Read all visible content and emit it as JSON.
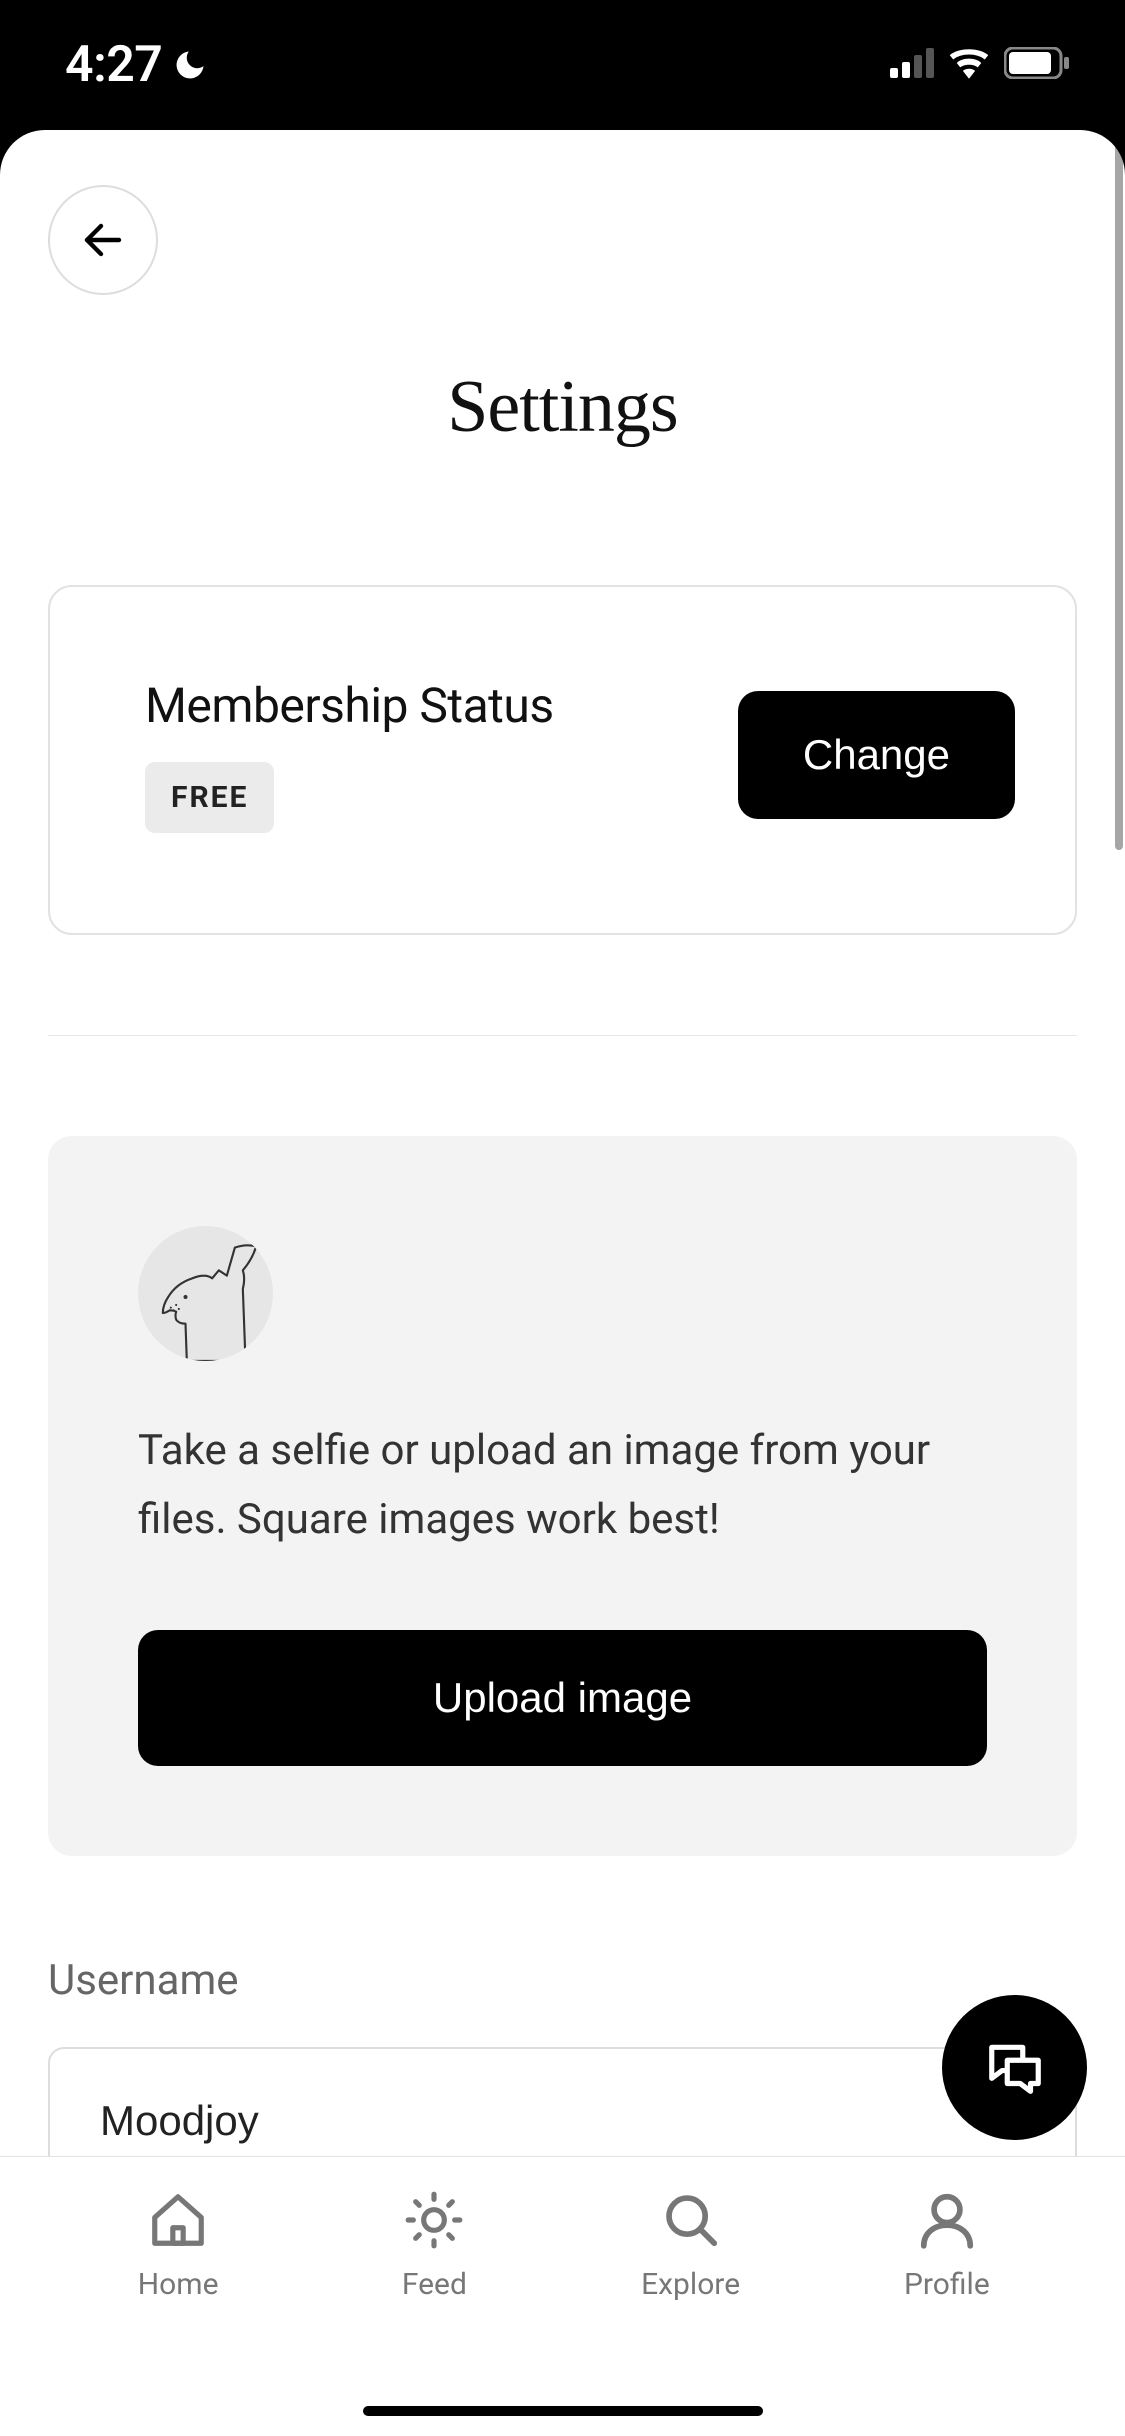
{
  "status_bar": {
    "time": "4:27"
  },
  "header": {
    "title": "Settings"
  },
  "membership": {
    "title": "Membership Status",
    "badge": "FREE",
    "change_label": "Change"
  },
  "upload": {
    "description": "Take a selfie or upload an image from your files. Square images work best!",
    "button_label": "Upload image"
  },
  "username": {
    "label": "Username",
    "value": "Moodjoy"
  },
  "tabs": [
    {
      "label": "Home"
    },
    {
      "label": "Feed"
    },
    {
      "label": "Explore"
    },
    {
      "label": "Profile"
    }
  ]
}
